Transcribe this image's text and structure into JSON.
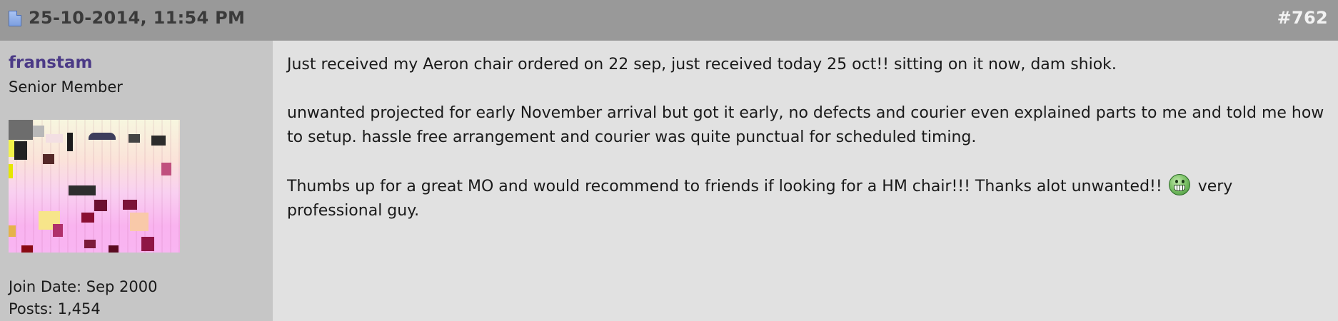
{
  "header": {
    "date_time": "25-10-2014, 11:54 PM",
    "post_number": "#762",
    "icon": "post-status-icon"
  },
  "user": {
    "username": "franstam",
    "title": "Senior Member",
    "avatar": "user-avatar-image",
    "join_date": "Join Date: Sep 2000",
    "posts": "Posts: 1,454"
  },
  "post": {
    "paragraph1": "Just received my Aeron chair ordered on 22 sep, just received today 25 oct!! sitting on it now, dam shiok.",
    "paragraph2": "unwanted projected for early November arrival but got it early, no defects and courier even explained parts to me and told me how to setup. hassle free arrangement and courier was quite punctual for scheduled timing.",
    "paragraph3_before": "Thumbs up for a great MO and would recommend to friends if looking for a HM chair!!! Thanks alot unwanted!!",
    "smiley": "grin-smiley-icon",
    "paragraph3_after": "very professional guy."
  },
  "colors": {
    "header_bg": "#999999",
    "user_panel_bg": "#c6c6c6",
    "body_bg": "#e1e1e1",
    "username": "#4b3a86"
  }
}
